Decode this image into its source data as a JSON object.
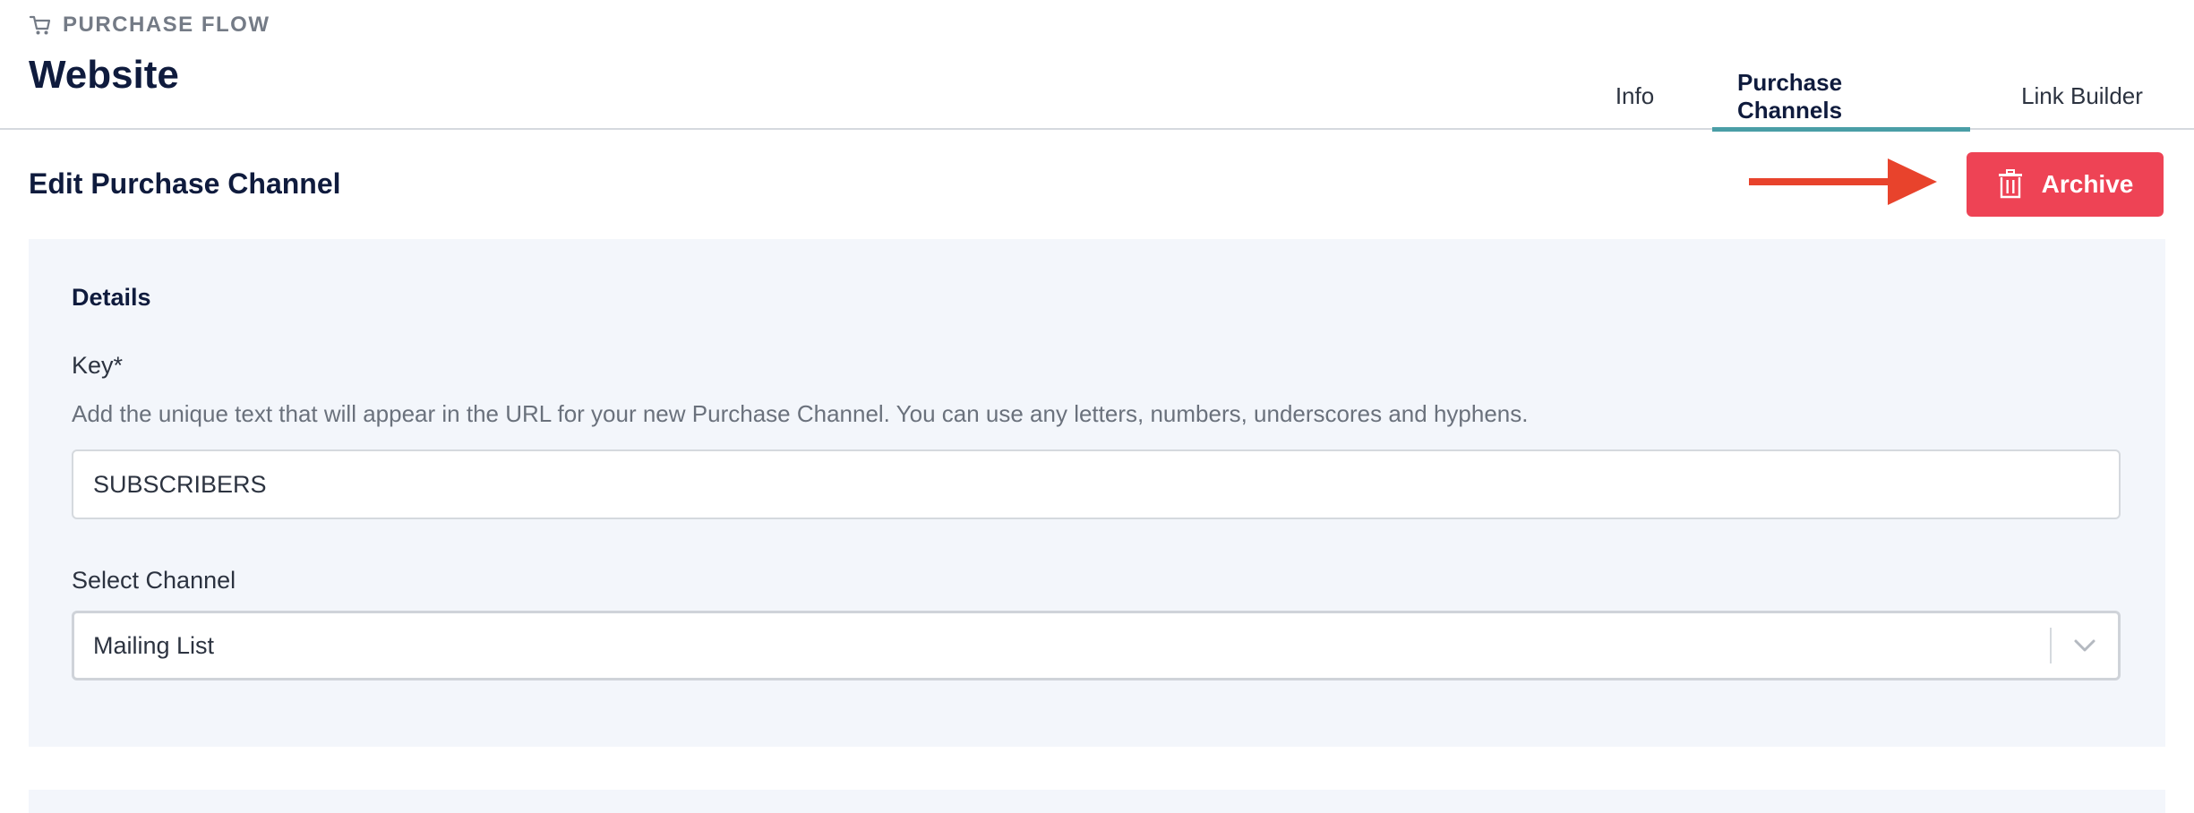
{
  "header": {
    "eyebrow_icon": "cart-icon",
    "eyebrow": "PURCHASE FLOW",
    "title": "Website",
    "tabs": [
      {
        "label": "Info",
        "active": false
      },
      {
        "label": "Purchase Channels",
        "active": true
      },
      {
        "label": "Link Builder",
        "active": false
      }
    ],
    "accent_color": "#4a9ea6"
  },
  "section": {
    "title": "Edit Purchase Channel",
    "annotation_icon": "arrow-right-icon",
    "annotation_color": "#e8432c",
    "archive_button": {
      "label": "Archive",
      "icon": "trash-icon",
      "color": "#ee4355"
    }
  },
  "details": {
    "title": "Details",
    "key": {
      "label": "Key*",
      "help": "Add the unique text that will appear in the URL for your new Purchase Channel. You can use any letters, numbers, underscores and hyphens.",
      "value": "SUBSCRIBERS"
    },
    "channel": {
      "label": "Select Channel",
      "value": "Mailing List",
      "icon": "chevron-down-icon"
    }
  }
}
